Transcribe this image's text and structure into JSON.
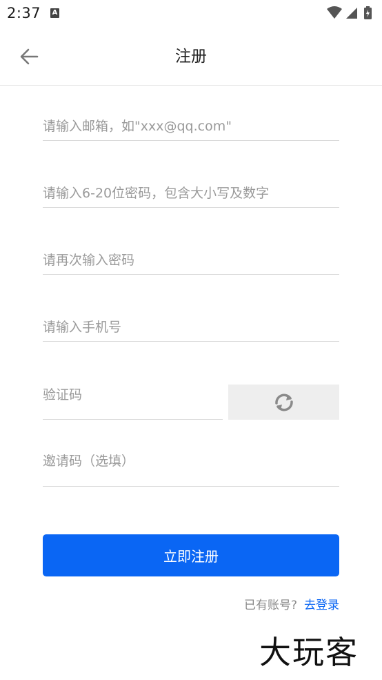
{
  "status_bar": {
    "time": "2:37",
    "notification_icon_letter": "A"
  },
  "header": {
    "title": "注册"
  },
  "form": {
    "email_placeholder": "请输入邮箱，如\"xxx@qq.com\"",
    "password_placeholder": "请输入6-20位密码，包含大小写及数字",
    "confirm_password_placeholder": "请再次输入密码",
    "phone_placeholder": "请输入手机号",
    "captcha_placeholder": "验证码",
    "invite_code_placeholder": "邀请码（选填）"
  },
  "actions": {
    "register_label": "立即注册",
    "have_account_text": "已有账号?",
    "login_link_label": "去登录"
  },
  "watermark": {
    "text": "大玩客"
  },
  "colors": {
    "primary": "#0a66f4",
    "placeholder": "#9a9a9a",
    "divider": "#d9d9d9"
  }
}
